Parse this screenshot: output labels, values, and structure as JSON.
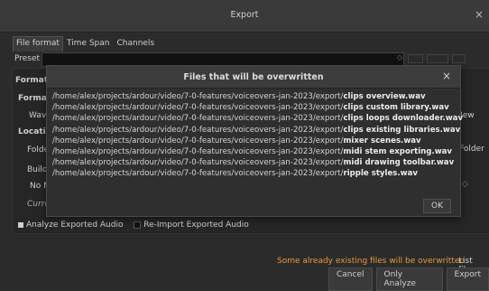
{
  "window": {
    "title": "Export",
    "close": "×"
  },
  "tabs": [
    "File format",
    "Time Span",
    "Channels"
  ],
  "preset": {
    "label": "Preset"
  },
  "background": {
    "format_tab": "Format",
    "format_label": "Forma",
    "wav_label": "Wav",
    "new_label": "New",
    "location_label": "Locatio",
    "folder_left": "Folde",
    "folder_right": "Folder",
    "build_label": "Build",
    "nonl_label": "No N",
    "current_label": "Curre",
    "analyze": "Analyze Exported Audio",
    "reimport": "Re-Import Exported Audio"
  },
  "footer": {
    "warning": "Some already existing files will be overwritten.",
    "list_files": "List files",
    "cancel": "Cancel",
    "only_analyze": "Only Analyze",
    "export": "Export"
  },
  "dialog": {
    "title": "Files that will be overwritten",
    "close": "×",
    "path_prefix": "/home/alex/projects/ardour/video/7-0-features/voiceovers-jan-2023/export/",
    "files": [
      "clips overview.wav",
      "clips custom library.wav",
      "clips loops downloader.wav",
      "clips existing libraries.wav",
      "mixer scenes.wav",
      "midi stem exporting.wav",
      "midi drawing toolbar.wav",
      "ripple styles.wav"
    ],
    "ok": "OK"
  }
}
